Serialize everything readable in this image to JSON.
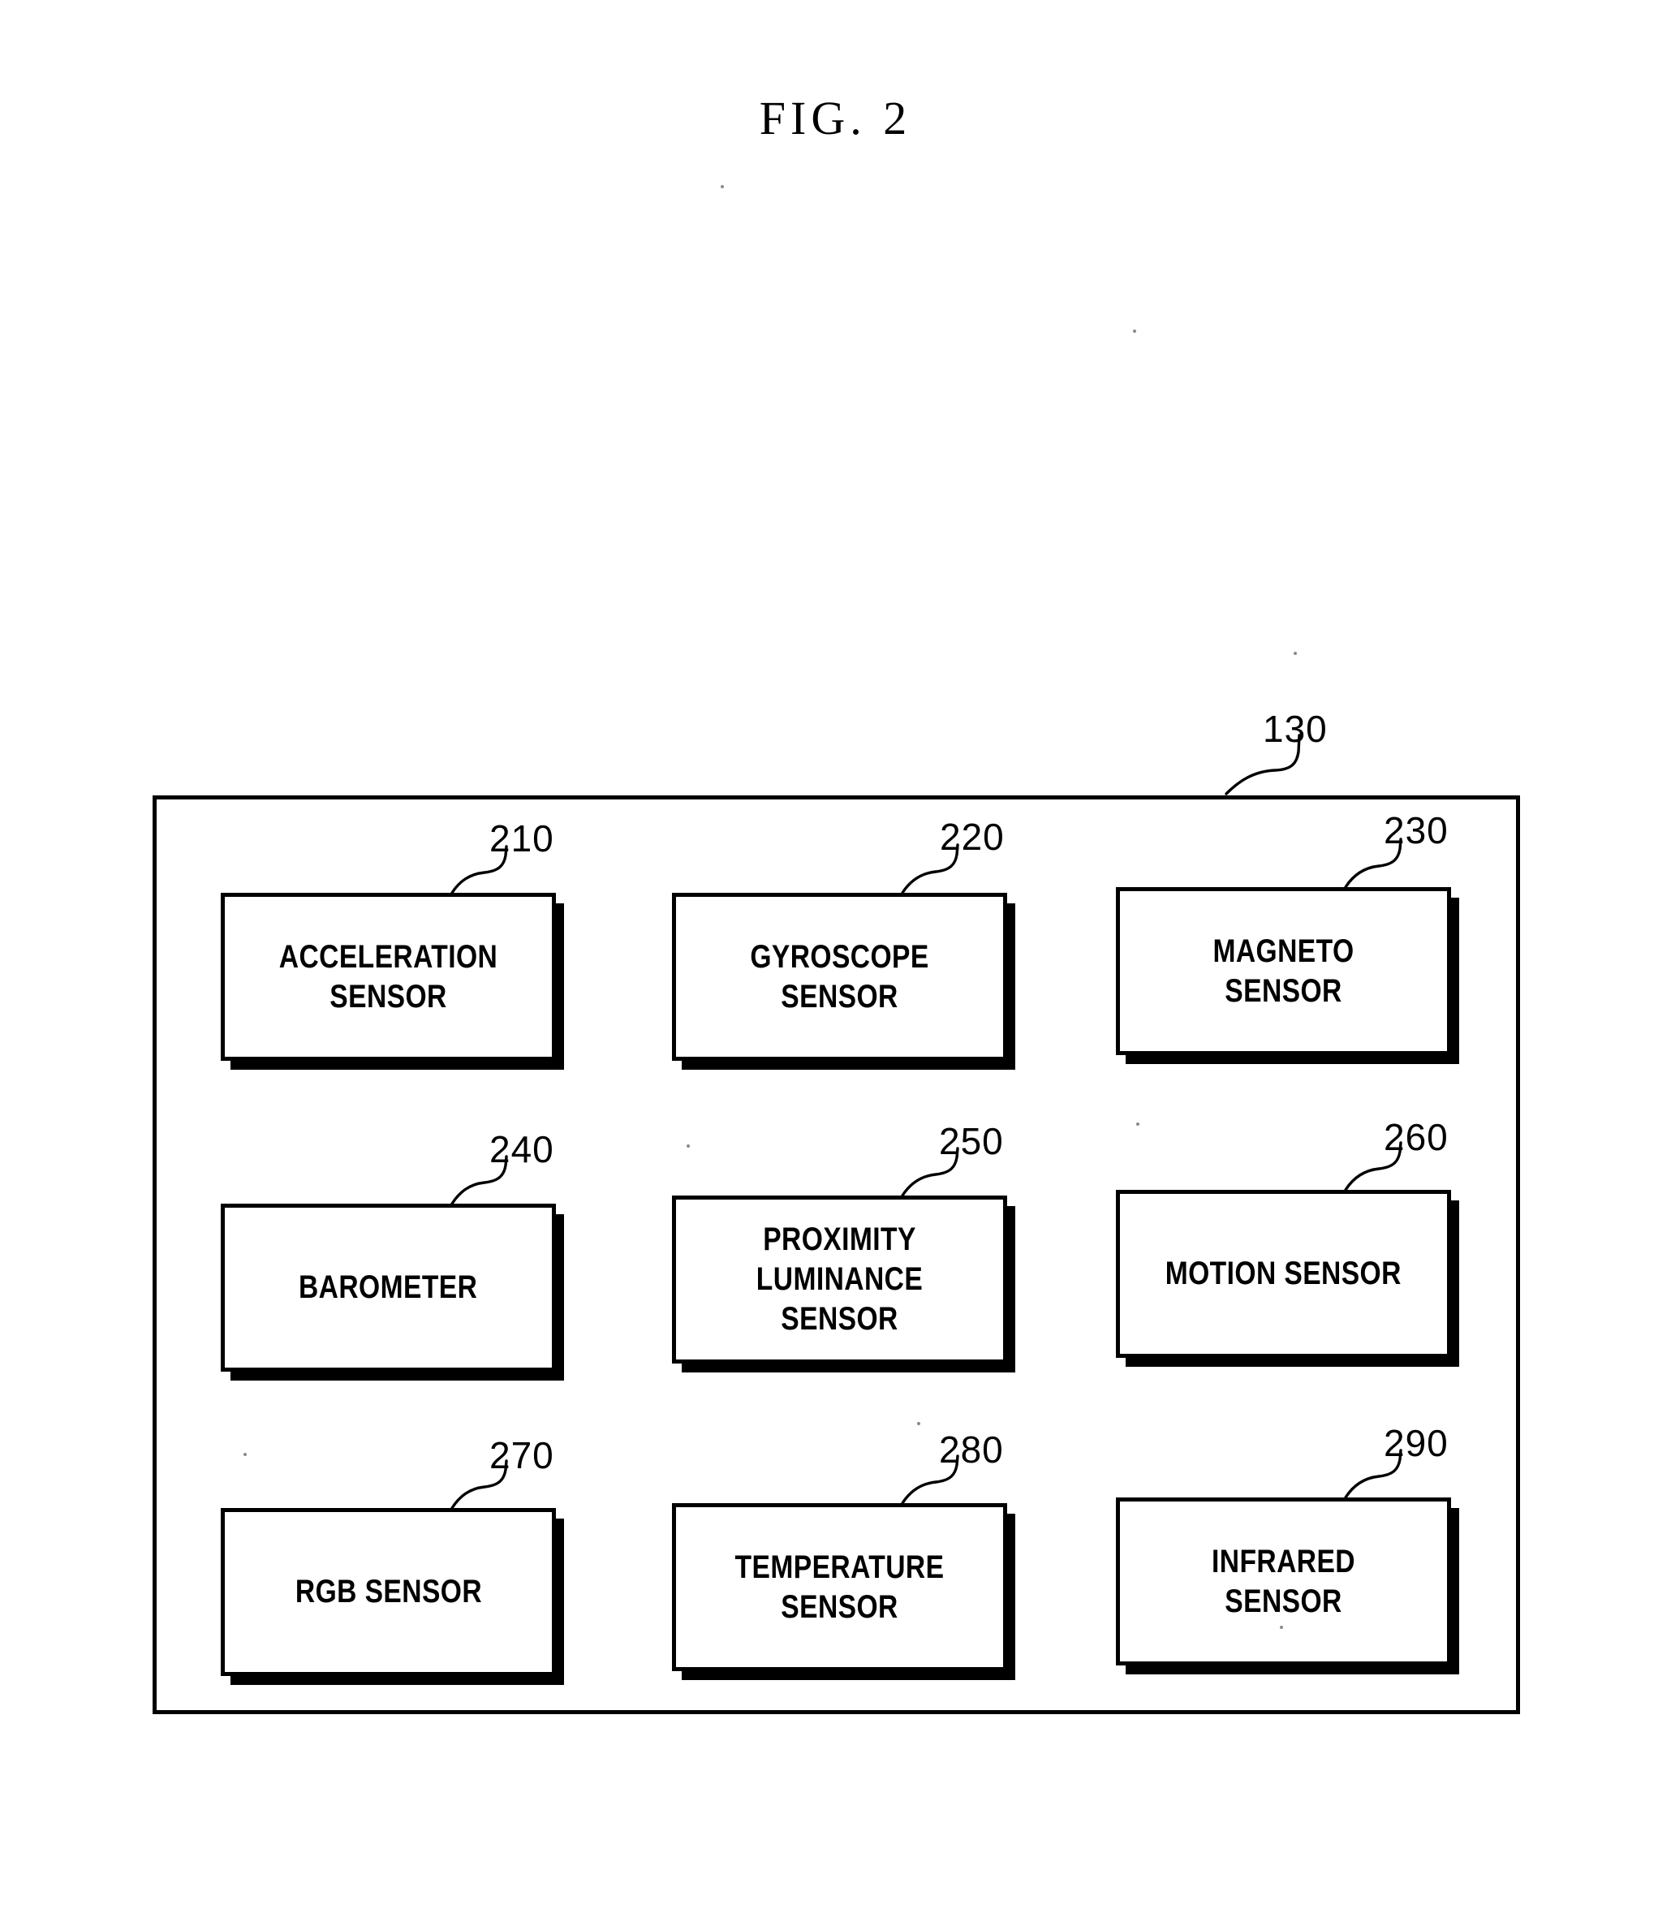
{
  "figure": {
    "title": "FIG. 2",
    "container_ref": "130"
  },
  "sensor_unit": {
    "ref": "130",
    "sensors": [
      {
        "ref": "210",
        "label": "ACCELERATION SENSOR"
      },
      {
        "ref": "220",
        "label": "GYROSCOPE SENSOR"
      },
      {
        "ref": "230",
        "label": "MAGNETO SENSOR"
      },
      {
        "ref": "240",
        "label": "BAROMETER"
      },
      {
        "ref": "250",
        "label": "PROXIMITY LUMINANCE\nSENSOR"
      },
      {
        "ref": "260",
        "label": "MOTION SENSOR"
      },
      {
        "ref": "270",
        "label": "RGB SENSOR"
      },
      {
        "ref": "280",
        "label": "TEMPERATURE SENSOR"
      },
      {
        "ref": "290",
        "label": "INFRARED SENSOR"
      }
    ]
  }
}
